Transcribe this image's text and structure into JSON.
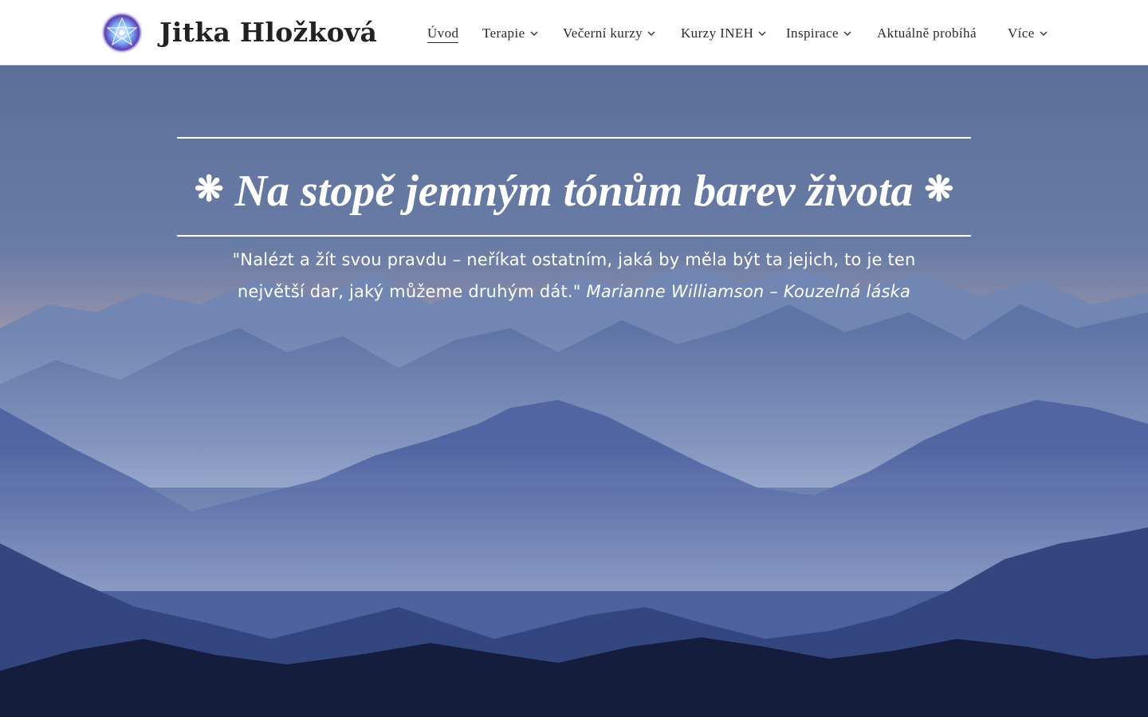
{
  "header": {
    "site_title": "Jitka Hložková",
    "logo_icon": "lotus-mandala-icon",
    "nav": [
      {
        "label": "Úvod",
        "active": true,
        "dropdown": false
      },
      {
        "label": "Terapie",
        "active": false,
        "dropdown": true
      },
      {
        "label": "Večerní kurzy",
        "active": false,
        "dropdown": true
      },
      {
        "label": "Kurzy INEH",
        "active": false,
        "dropdown": true
      },
      {
        "label": "Inspirace",
        "active": false,
        "dropdown": true
      },
      {
        "label": "Aktuálně probíhá",
        "active": false,
        "dropdown": false
      },
      {
        "label": "Více",
        "active": false,
        "dropdown": true
      }
    ]
  },
  "hero": {
    "star_left": "❋",
    "headline": "Na stopě jemným tónům barev života",
    "star_right": "❋",
    "quote_text": "\"Nalézt a žít svou pravdu – neříkat ostatním, jaká by měla být ta jejich, to je ten největší dar, jaký můžeme druhým dát.\" ",
    "quote_author": "Marianne Williamson – Kouzelná láska",
    "background_image": "misty-blue-mountains"
  },
  "colors": {
    "header_bg": "#ffffff",
    "text_dark": "#2a2a2a",
    "hero_text": "#ffffff",
    "sky_top": "#5b6f99",
    "mountain_far": "#8fa3c8",
    "mountain_dark": "#141d3b"
  }
}
